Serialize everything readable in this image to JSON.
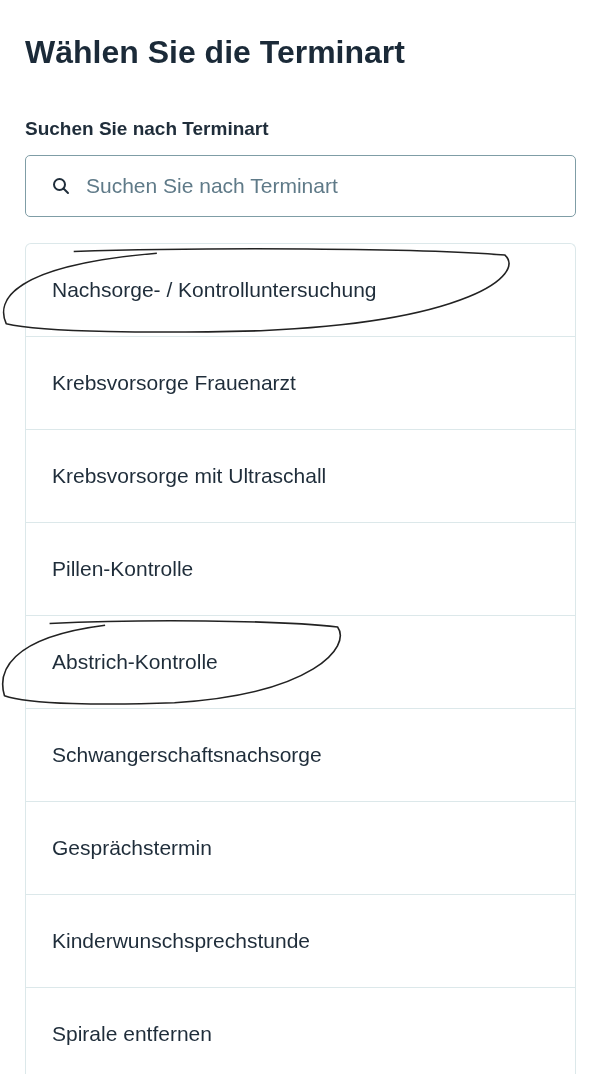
{
  "title": "Wählen Sie die Terminart",
  "search": {
    "label": "Suchen Sie nach Terminart",
    "placeholder": "Suchen Sie nach Terminart"
  },
  "items": [
    {
      "label": "Nachsorge- / Kontrolluntersuchung",
      "circled": true
    },
    {
      "label": "Krebsvorsorge Frauenarzt",
      "circled": false
    },
    {
      "label": "Krebsvorsorge mit Ultraschall",
      "circled": false
    },
    {
      "label": "Pillen-Kontrolle",
      "circled": false
    },
    {
      "label": "Abstrich-Kontrolle",
      "circled": true
    },
    {
      "label": "Schwangerschaftsnachsorge",
      "circled": false
    },
    {
      "label": "Gesprächstermin",
      "circled": false
    },
    {
      "label": "Kinderwunschsprechstunde",
      "circled": false
    },
    {
      "label": "Spirale entfernen",
      "circled": false
    }
  ]
}
